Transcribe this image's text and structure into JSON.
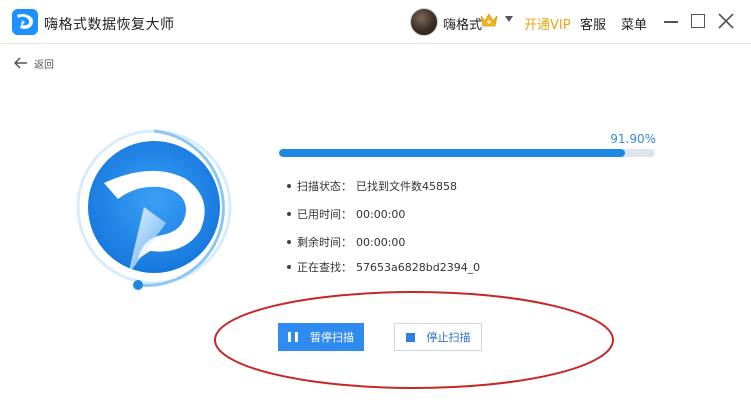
{
  "titlebar": {
    "app_title": "嗨格式数据恢复大师",
    "username": "嗨格式",
    "vip_label": "开通VIP",
    "service_label": "客服",
    "menu_label": "菜单"
  },
  "back": {
    "label": "返回"
  },
  "progress": {
    "percent_text": "91.90%",
    "fraction": 0.919
  },
  "status": [
    {
      "label": "扫描状态：",
      "value": "已找到文件数45858"
    },
    {
      "label": "已用时间：",
      "value": "00:00:00"
    },
    {
      "label": "剩余时间：",
      "value": "00:00:00"
    },
    {
      "label": "正在查找：",
      "value": "57653a6828bd2394_0"
    }
  ],
  "buttons": {
    "pause_label": "暂停扫描",
    "stop_label": "停止扫描"
  },
  "icons": {
    "app_logo": "logo-icon",
    "crown": "crown-icon",
    "dropdown": "chevron-down-icon",
    "minimize": "minimize-icon",
    "maximize": "maximize-icon",
    "close": "close-icon",
    "back": "arrow-left-icon",
    "pause": "pause-icon",
    "stop": "stop-icon"
  },
  "colors": {
    "accent": "#1e88e5",
    "vip": "#e6a817",
    "annotation": "#c62828"
  }
}
